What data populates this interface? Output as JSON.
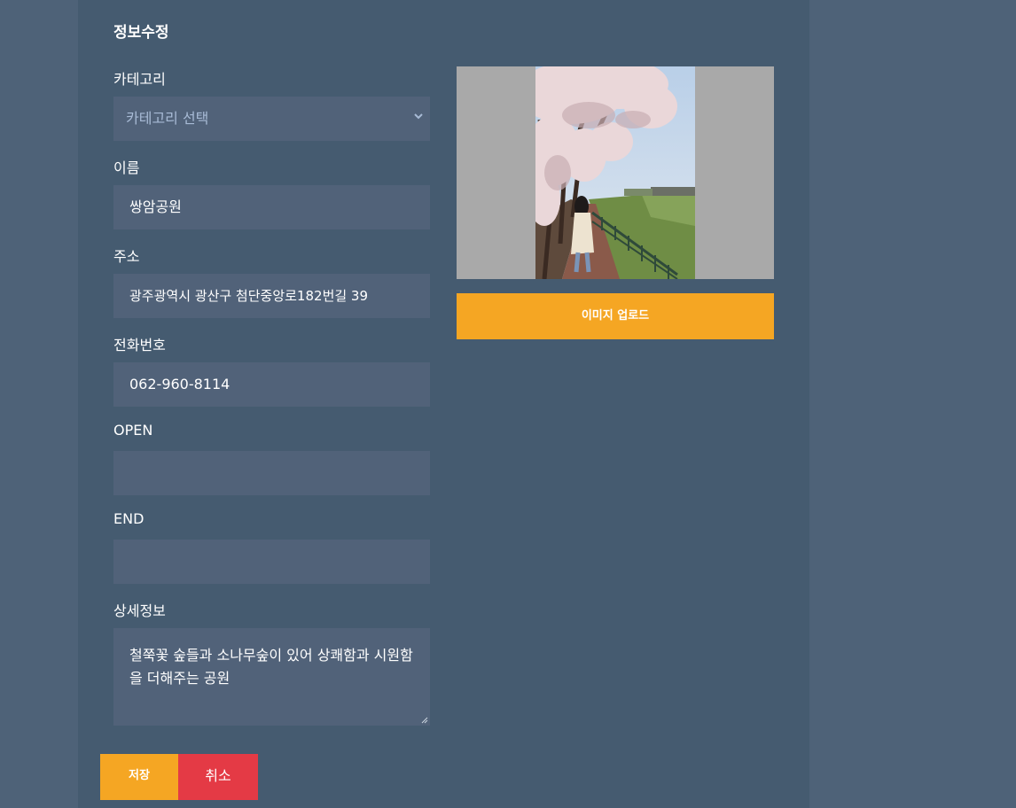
{
  "form": {
    "title": "정보수정",
    "category": {
      "label": "카테고리",
      "value": "카테고리 선택"
    },
    "name": {
      "label": "이름",
      "value": "쌍암공원"
    },
    "address": {
      "label": "주소",
      "value": "광주광역시 광산구 첨단중앙로182번길 39"
    },
    "phone": {
      "label": "전화번호",
      "value": "062-960-8114"
    },
    "open": {
      "label": "OPEN",
      "value": ""
    },
    "end": {
      "label": "END",
      "value": ""
    },
    "detail": {
      "label": "상세정보",
      "value": "철쭉꽃 숲들과 소나무숲이 있어 상쾌함과 시원함을 더해주는 공원"
    }
  },
  "image": {
    "upload_label": "이미지 업로드"
  },
  "actions": {
    "save_label": "저장",
    "cancel_label": "취소"
  },
  "colors": {
    "page_bg": "#4e6278",
    "panel_bg": "#455b70",
    "field_bg": "#516279",
    "accent": "#f5a623",
    "danger": "#e43a45"
  },
  "icons": {
    "select_chevron": "chevron-down-icon",
    "resize": "resize-grip-icon"
  }
}
